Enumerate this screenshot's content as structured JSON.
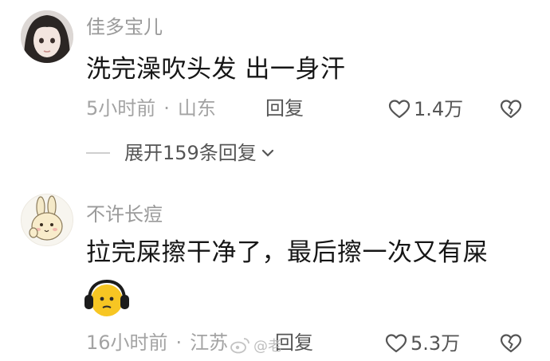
{
  "comments": [
    {
      "username": "佳多宝儿",
      "content": "洗完澡吹头发 出一身汗",
      "time": "5小时前",
      "location": "山东",
      "reply_label": "回复",
      "likes": "1.4万",
      "avatar": "girl-portrait-avatar"
    },
    {
      "username": "不许长痘",
      "content": "拉完屎擦干净了，最后擦一次又有屎",
      "time": "16小时前",
      "location": "江苏",
      "reply_label": "回复",
      "likes": "5.3万",
      "avatar": "rabbit-cartoon-avatar",
      "emoji": "headphone-face-emoji"
    }
  ],
  "thread": {
    "expand_label": "展开159条回复"
  },
  "watermark": {
    "text": "@老"
  }
}
